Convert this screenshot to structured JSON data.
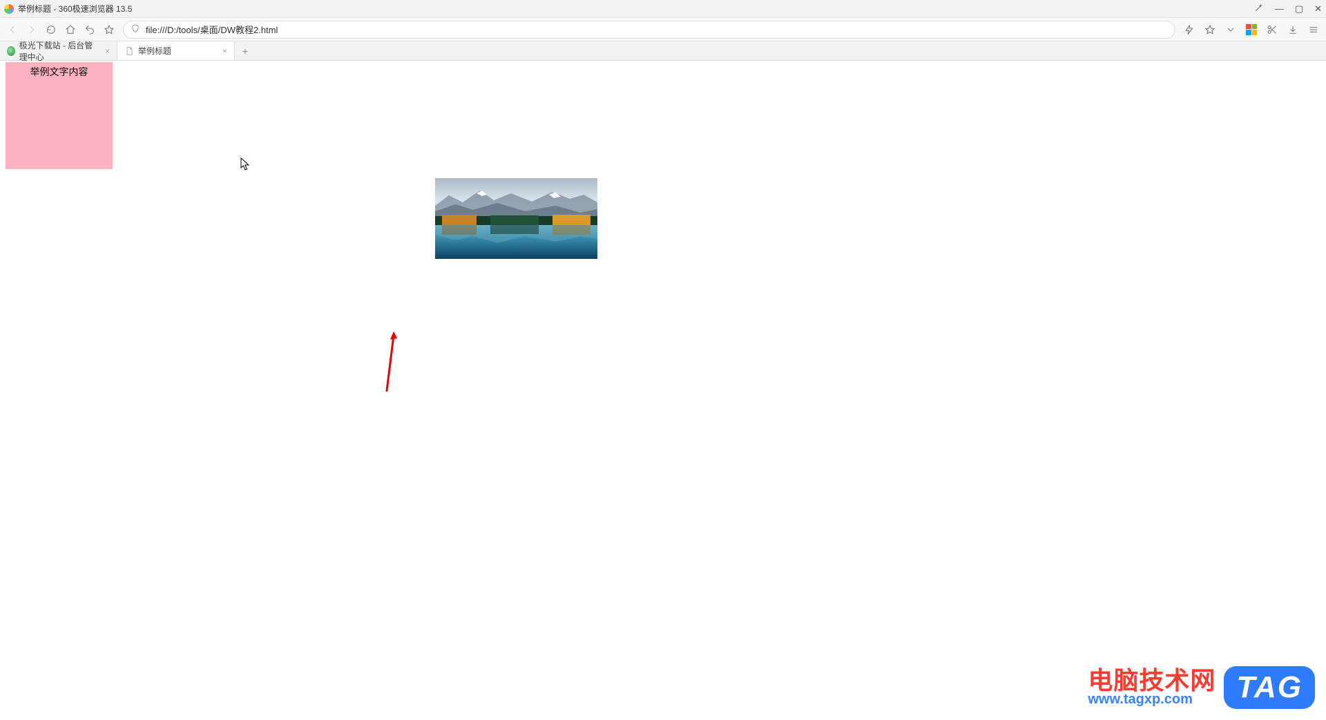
{
  "window": {
    "title": "举例标题 - 360极速浏览器 13.5"
  },
  "navbar": {
    "url": "file:///D:/tools/桌面/DW教程2.html"
  },
  "tabs": [
    {
      "label": "极光下载站 - 后台管理中心",
      "active": false
    },
    {
      "label": "举例标题",
      "active": true
    }
  ],
  "page": {
    "pinkbox_text": "举例文字内容"
  },
  "watermark": {
    "cn": "电脑技术网",
    "url": "www.tagxp.com",
    "tag": "TAG"
  }
}
